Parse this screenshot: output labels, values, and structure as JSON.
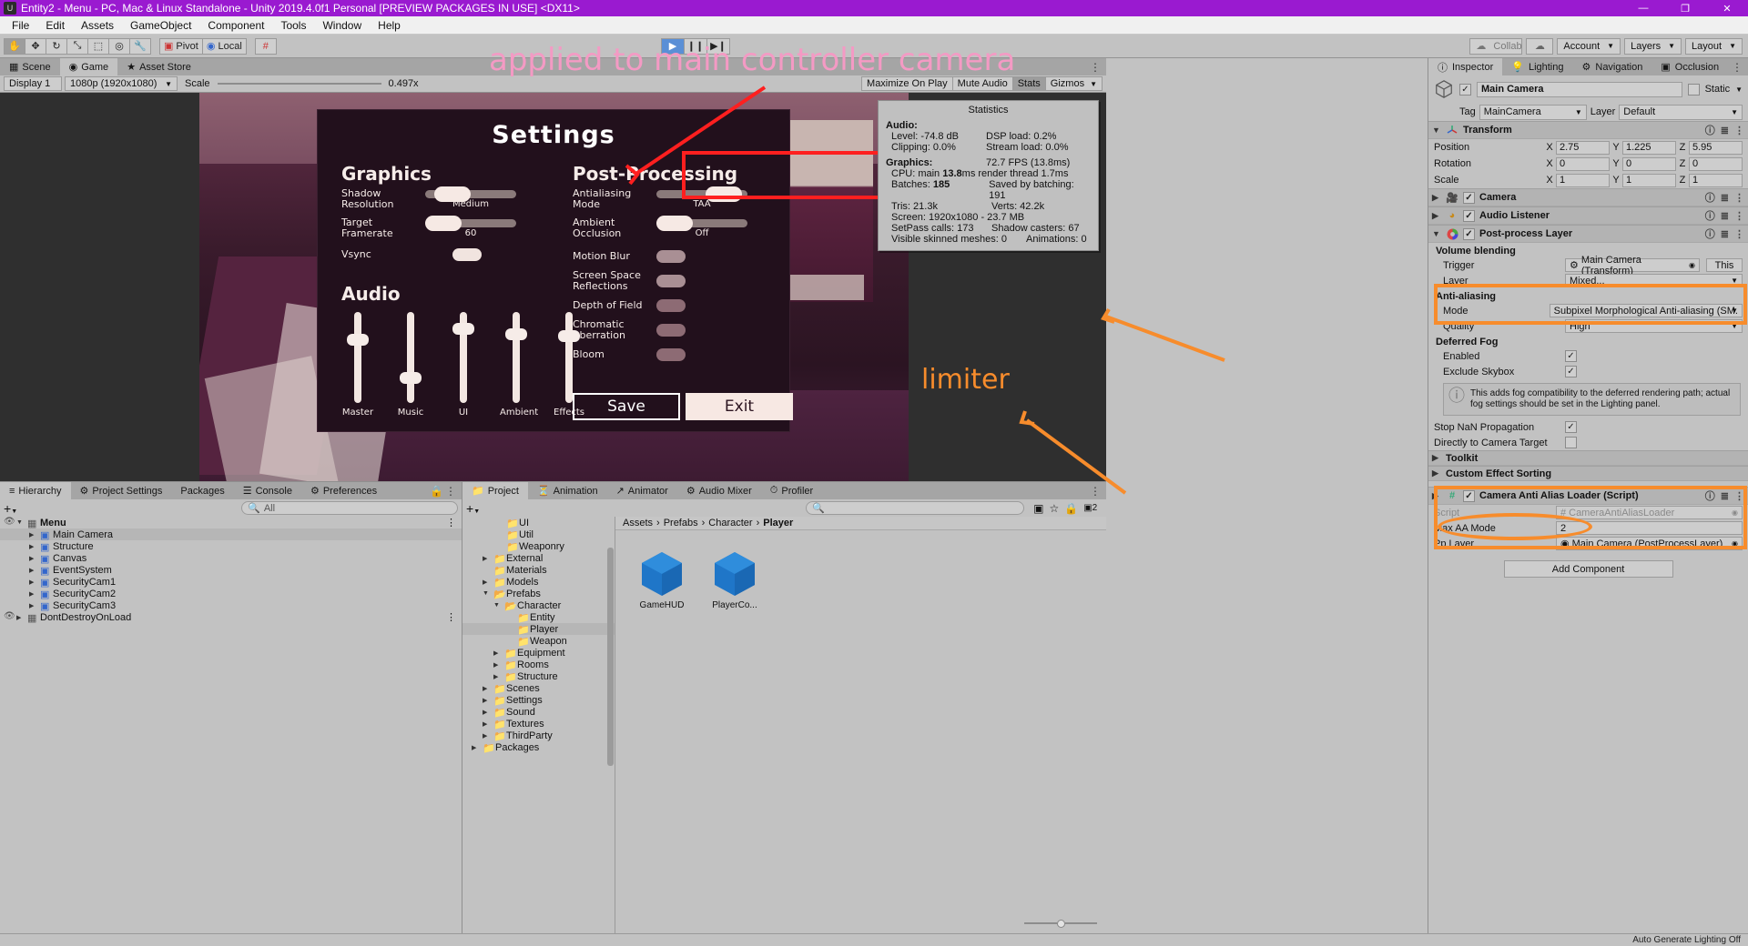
{
  "window": {
    "title": "Entity2 - Menu - PC, Mac & Linux Standalone - Unity 2019.4.0f1 Personal [PREVIEW PACKAGES IN USE] <DX11>",
    "minimize": "—",
    "maximize": "❐",
    "close": "✕"
  },
  "menu": {
    "items": [
      "File",
      "Edit",
      "Assets",
      "GameObject",
      "Component",
      "Tools",
      "Window",
      "Help"
    ]
  },
  "toolbar": {
    "transform_tools": [
      "✋",
      "✥",
      "↻",
      "⤡",
      "⬚",
      "◎",
      "🔧"
    ],
    "pivot": "Pivot",
    "local": "Local",
    "grid": "#",
    "play": "▶",
    "pause": "❙❙",
    "step": "▶❙",
    "collab": "Collab",
    "cloud": "☁",
    "account": "Account",
    "layers": "Layers",
    "layout": "Layout"
  },
  "game_panel": {
    "tabs": [
      {
        "label": "Scene",
        "icon": "scene-icon",
        "selected": false
      },
      {
        "label": "Game",
        "icon": "game-icon",
        "selected": true
      },
      {
        "label": "Asset Store",
        "icon": "store-icon",
        "selected": false
      }
    ],
    "display": "Display 1",
    "resolution": "1080p (1920x1080)",
    "scale_label": "Scale",
    "scale_value": "0.497х",
    "maximize_on_play": "Maximize On Play",
    "mute_audio": "Mute Audio",
    "stats": "Stats",
    "gizmos": "Gizmos"
  },
  "statistics": {
    "title": "Statistics",
    "audio_header": "Audio:",
    "audio_left": [
      "Level: -74.8 dB",
      "Clipping: 0.0%"
    ],
    "audio_right": [
      "DSP load: 0.2%",
      "Stream load: 0.0%"
    ],
    "graphics_header": "Graphics:",
    "fps": "72.7 FPS (13.8ms)",
    "cpu_prefix": "CPU: main ",
    "cpu_main": "13.8",
    "cpu_suffix": "ms  render thread 1.7ms",
    "batches_prefix": "Batches: ",
    "batches": "185",
    "saved_by_batching": "Saved by batching: 191",
    "tris": "Tris: 21.3k",
    "verts": "Verts: 42.2k",
    "screen": "Screen: 1920x1080 - 23.7 MB",
    "setpass": "SetPass calls: 173",
    "shadow_casters": "Shadow casters: 67",
    "skinned": "Visible skinned meshes: 0",
    "animations": "Animations: 0"
  },
  "game_ui": {
    "title": "Settings",
    "graphics_header": "Graphics",
    "shadow_resolution_label": "Shadow\nResolution",
    "shadow_resolution_value": "Medium",
    "target_framerate_label": "Target\nFramerate",
    "target_framerate_value": "60",
    "vsync_label": "Vsync",
    "audio_header": "Audio",
    "faders": [
      {
        "label": "Master",
        "value": 70
      },
      {
        "label": "Music",
        "value": 30
      },
      {
        "label": "UI",
        "value": 82
      },
      {
        "label": "Ambient",
        "value": 76
      },
      {
        "label": "Effects",
        "value": 74
      }
    ],
    "post_processing_header": "Post-Processing",
    "antialiasing_label": "Antialiasing\nMode",
    "antialiasing_value": "TAA",
    "ambient_occlusion_label": "Ambient\nOcclusion",
    "ambient_occlusion_value": "Off",
    "toggles": [
      {
        "label": "Motion Blur",
        "state": "off"
      },
      {
        "label": "Screen Space\nReflections",
        "state": "off"
      },
      {
        "label": "Depth of Field",
        "state": "dim"
      },
      {
        "label": "Chromatic\nAberration",
        "state": "dim"
      },
      {
        "label": "Bloom",
        "state": "dim"
      }
    ],
    "save_button": "Save",
    "exit_button": "Exit"
  },
  "annotations": {
    "camera_note": "applied to main controller camera",
    "limiter_note": "limiter"
  },
  "inspector": {
    "tabs": [
      {
        "label": "Inspector",
        "icon": "info-icon",
        "selected": true
      },
      {
        "label": "Lighting",
        "icon": "bulb-icon",
        "selected": false
      },
      {
        "label": "Navigation",
        "icon": "nav-icon",
        "selected": false
      },
      {
        "label": "Occlusion",
        "icon": "occlusion-icon",
        "selected": false
      }
    ],
    "object_name": "Main Camera",
    "static_label": "Static",
    "tag_label": "Tag",
    "tag_value": "MainCamera",
    "layer_label": "Layer",
    "layer_value": "Default",
    "transform": {
      "title": "Transform",
      "rows": [
        {
          "label": "Position",
          "x": "2.75",
          "y": "1.225",
          "z": "5.95"
        },
        {
          "label": "Rotation",
          "x": "0",
          "y": "0",
          "z": "0"
        },
        {
          "label": "Scale",
          "x": "1",
          "y": "1",
          "z": "1"
        }
      ]
    },
    "components": [
      {
        "title": "Camera",
        "icon": "camera-icon"
      },
      {
        "title": "Audio Listener",
        "icon": "headphones-icon"
      },
      {
        "title": "Post-process Layer",
        "icon": "postprocess-icon"
      }
    ],
    "postprocess": {
      "volume_blending": "Volume blending",
      "trigger_label": "Trigger",
      "trigger_value": "Main Camera (Transform)",
      "this_button": "This",
      "layer_label": "Layer",
      "layer_value": "Mixed...",
      "antialiasing_header": "Anti-aliasing",
      "mode_label": "Mode",
      "mode_value": "Subpixel Morphological Anti-aliasing (SM.",
      "quality_label": "Quality",
      "quality_value": "High",
      "deferred_fog_header": "Deferred Fog",
      "enabled_label": "Enabled",
      "exclude_skybox_label": "Exclude Skybox",
      "help_text": "This adds fog compatibility to the deferred rendering path; actual fog settings should be set in the Lighting panel.",
      "stop_nan_label": "Stop NaN Propagation",
      "directly_to_camera_label": "Directly to Camera Target",
      "toolkit": "Toolkit",
      "custom_effect_sorting": "Custom Effect Sorting"
    },
    "script_component": {
      "title": "Camera Anti Alias Loader (Script)",
      "script_label": "Script",
      "script_value": "CameraAntiAliasLoader",
      "max_aa_mode_label": "Max AA Mode",
      "max_aa_mode_value": "2",
      "pp_layer_label": "Pp Layer",
      "pp_layer_value": "Main Camera (PostProcessLayer)"
    },
    "add_component": "Add Component"
  },
  "hierarchy": {
    "tabs": [
      {
        "label": "Hierarchy",
        "icon": "hierarchy-icon",
        "selected": true
      },
      {
        "label": "Project Settings",
        "icon": "gear-icon",
        "selected": false
      },
      {
        "label": "Packages",
        "icon": "",
        "selected": false
      },
      {
        "label": "Console",
        "icon": "console-icon",
        "selected": false
      },
      {
        "label": "Preferences",
        "icon": "gear-icon",
        "selected": false
      }
    ],
    "search_placeholder": "All",
    "add_label": "+",
    "items": [
      {
        "label": "Menu",
        "depth": 0,
        "expanded": true,
        "bold": true,
        "selected": false,
        "icon": "scene-icon"
      },
      {
        "label": "Main Camera",
        "depth": 1,
        "expanded": false,
        "selected": true,
        "icon": "gameobject-icon"
      },
      {
        "label": "Structure",
        "depth": 1,
        "expanded": false,
        "selected": false,
        "icon": "gameobject-icon"
      },
      {
        "label": "Canvas",
        "depth": 1,
        "expanded": false,
        "selected": false,
        "icon": "gameobject-icon"
      },
      {
        "label": "EventSystem",
        "depth": 1,
        "expanded": false,
        "selected": false,
        "icon": "gameobject-icon"
      },
      {
        "label": "SecurityCam1",
        "depth": 1,
        "expanded": false,
        "selected": false,
        "icon": "gameobject-icon"
      },
      {
        "label": "SecurityCam2",
        "depth": 1,
        "expanded": false,
        "selected": false,
        "icon": "gameobject-icon"
      },
      {
        "label": "SecurityCam3",
        "depth": 1,
        "expanded": false,
        "selected": false,
        "icon": "gameobject-icon"
      },
      {
        "label": "DontDestroyOnLoad",
        "depth": 0,
        "expanded": false,
        "selected": false,
        "icon": "scene-icon"
      }
    ]
  },
  "project": {
    "tabs": [
      {
        "label": "Project",
        "icon": "folder-icon",
        "selected": true
      },
      {
        "label": "Animation",
        "icon": "clock-icon",
        "selected": false
      },
      {
        "label": "Animator",
        "icon": "animator-icon",
        "selected": false
      },
      {
        "label": "Audio Mixer",
        "icon": "mixer-icon",
        "selected": false
      },
      {
        "label": "Profiler",
        "icon": "profiler-icon",
        "selected": false
      }
    ],
    "search_placeholder": "",
    "tree": [
      {
        "label": "UI",
        "depth": 2,
        "arrow": "",
        "open": false
      },
      {
        "label": "Util",
        "depth": 2,
        "arrow": "",
        "open": false
      },
      {
        "label": "Weaponry",
        "depth": 2,
        "arrow": "",
        "open": false
      },
      {
        "label": "External",
        "depth": 1,
        "arrow": "▶",
        "open": false
      },
      {
        "label": "Materials",
        "depth": 1,
        "arrow": "",
        "open": false
      },
      {
        "label": "Models",
        "depth": 1,
        "arrow": "▶",
        "open": false
      },
      {
        "label": "Prefabs",
        "depth": 1,
        "arrow": "▼",
        "open": true
      },
      {
        "label": "Character",
        "depth": 2,
        "arrow": "▼",
        "open": true
      },
      {
        "label": "Entity",
        "depth": 3,
        "arrow": "",
        "open": false
      },
      {
        "label": "Player",
        "depth": 3,
        "arrow": "",
        "open": false,
        "selected": true
      },
      {
        "label": "Weapon",
        "depth": 3,
        "arrow": "",
        "open": false
      },
      {
        "label": "Equipment",
        "depth": 2,
        "arrow": "▶",
        "open": false
      },
      {
        "label": "Rooms",
        "depth": 2,
        "arrow": "▶",
        "open": false
      },
      {
        "label": "Structure",
        "depth": 2,
        "arrow": "▶",
        "open": false
      },
      {
        "label": "Scenes",
        "depth": 1,
        "arrow": "▶",
        "open": false
      },
      {
        "label": "Settings",
        "depth": 1,
        "arrow": "▶",
        "open": false
      },
      {
        "label": "Sound",
        "depth": 1,
        "arrow": "▶",
        "open": false
      },
      {
        "label": "Textures",
        "depth": 1,
        "arrow": "▶",
        "open": false
      },
      {
        "label": "ThirdParty",
        "depth": 1,
        "arrow": "▶",
        "open": false
      },
      {
        "label": "Packages",
        "depth": 0,
        "arrow": "▶",
        "open": false
      }
    ],
    "breadcrumb": [
      "Assets",
      "Prefabs",
      "Character",
      "Player"
    ],
    "assets": [
      {
        "label": "GameHUD",
        "icon": "prefab-icon"
      },
      {
        "label": "PlayerCo...",
        "icon": "prefab-icon"
      }
    ]
  },
  "status_bar": {
    "text": "Auto Generate Lighting Off"
  },
  "colors": {
    "title_bar": "#9a1ad0",
    "accent_orange": "#f78c2c",
    "accent_red": "#ff1f1f",
    "accent_pink": "#f49ac4",
    "panel_bg": "#c2c2c2",
    "selection": "#b6b6b6"
  }
}
